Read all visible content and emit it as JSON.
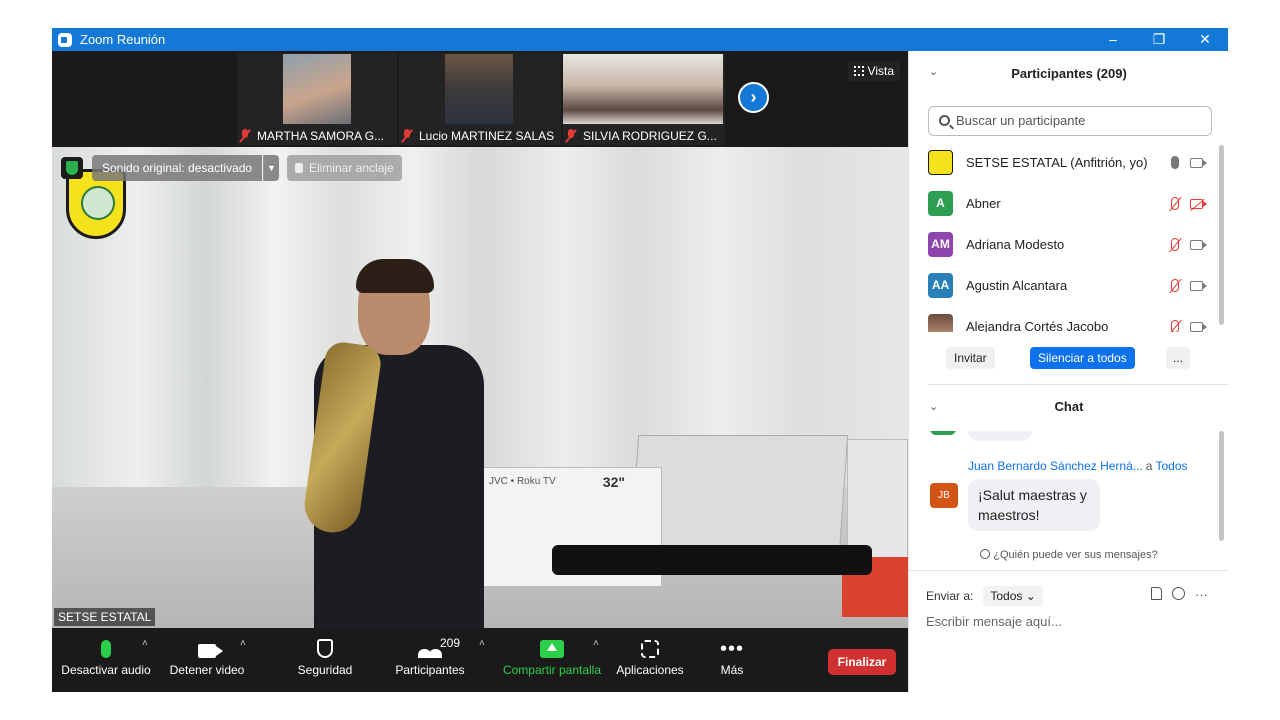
{
  "window": {
    "title": "Zoom Reunión",
    "controls": [
      "–",
      "❐",
      "✕"
    ]
  },
  "thumbnails": [
    {
      "name": "MARTHA SAMORA G...",
      "mic_muted": true
    },
    {
      "name": "Lucio MARTINEZ SALAS",
      "mic_muted": true
    },
    {
      "name": "SILVIA RODRIGUEZ G...",
      "mic_muted": true
    }
  ],
  "strip": {
    "next_label": "›",
    "view_label": "Vista"
  },
  "stage": {
    "original_sound": "Sonido original: desactivado",
    "unpin": "Eliminar anclaje",
    "speaker": "SETSE ESTATAL",
    "scene_tv_brand": "JVC • Roku TV",
    "scene_tv_size": "32\""
  },
  "toolbar": {
    "mute": "Desactivar audio",
    "video": "Detener video",
    "security": "Seguridad",
    "participants": "Participantes",
    "participant_count": "209",
    "share": "Compartir pantalla",
    "apps": "Aplicaciones",
    "more": "Más",
    "end": "Finalizar",
    "caret": "˄",
    "dots": "•••"
  },
  "participants_panel": {
    "title": "Participantes (209)",
    "collapse": "⌄",
    "search_placeholder": "Buscar un participante",
    "items": [
      {
        "initials": "",
        "name": "SETSE ESTATAL (Anfitrión, yo)",
        "color": "#f6e21c",
        "mic_muted": false,
        "cam_off": false
      },
      {
        "initials": "A",
        "name": "Abner",
        "color": "#2e9e52",
        "mic_muted": true,
        "cam_off": true
      },
      {
        "initials": "AM",
        "name": "Adriana Modesto",
        "color": "#8e44ad",
        "mic_muted": true,
        "cam_off": false
      },
      {
        "initials": "AA",
        "name": "Agustin Alcantara",
        "color": "#2980b9",
        "mic_muted": true,
        "cam_off": false
      },
      {
        "initials": "",
        "name": "Alejandra Cortés Jacobo",
        "color": "#a0745a",
        "mic_muted": true,
        "cam_off": false
      }
    ],
    "invite": "Invitar",
    "mute_all": "Silenciar a todos",
    "more": "..."
  },
  "chat": {
    "title": "Chat",
    "collapse": "⌄",
    "sender": "Juan Bernardo Sánchez Herná...",
    "to_word": "a",
    "recipient": "Todos",
    "sender_initials": "JB",
    "message": "¡Salut maestras y maestros!",
    "who_sees": "¿Quién puede ver sus mensajes?",
    "send_to_label": "Enviar a:",
    "send_to_value": "Todos ⌄",
    "more": "···",
    "input_placeholder": "Escribir mensaje aquí..."
  },
  "colors": {
    "accent": "#0e72ed",
    "titlebar": "#1479d6",
    "end": "#d0302f",
    "green": "#2bd04a"
  }
}
